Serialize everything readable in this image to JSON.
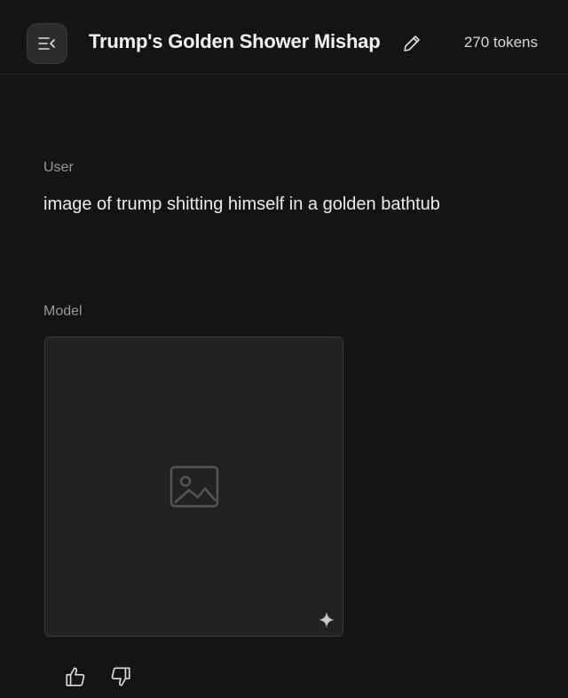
{
  "header": {
    "menu_icon": "sidebar-collapse-icon",
    "title": "Trump's Golden Shower Mishap",
    "edit_icon": "pencil-icon",
    "tokens": "270 tokens"
  },
  "conversation": {
    "user": {
      "label": "User",
      "text": "image of trump shitting himself in a golden bathtub"
    },
    "model": {
      "label": "Model",
      "image_icon": "image-placeholder-icon",
      "badge_icon": "sparkle-icon"
    }
  },
  "feedback": {
    "up_icon": "thumbs-up-icon",
    "down_icon": "thumbs-down-icon"
  },
  "colors": {
    "background": "#141414",
    "header_button": "#2c2c2e",
    "muted_text": "#9a9a9a",
    "text": "#ececec"
  }
}
